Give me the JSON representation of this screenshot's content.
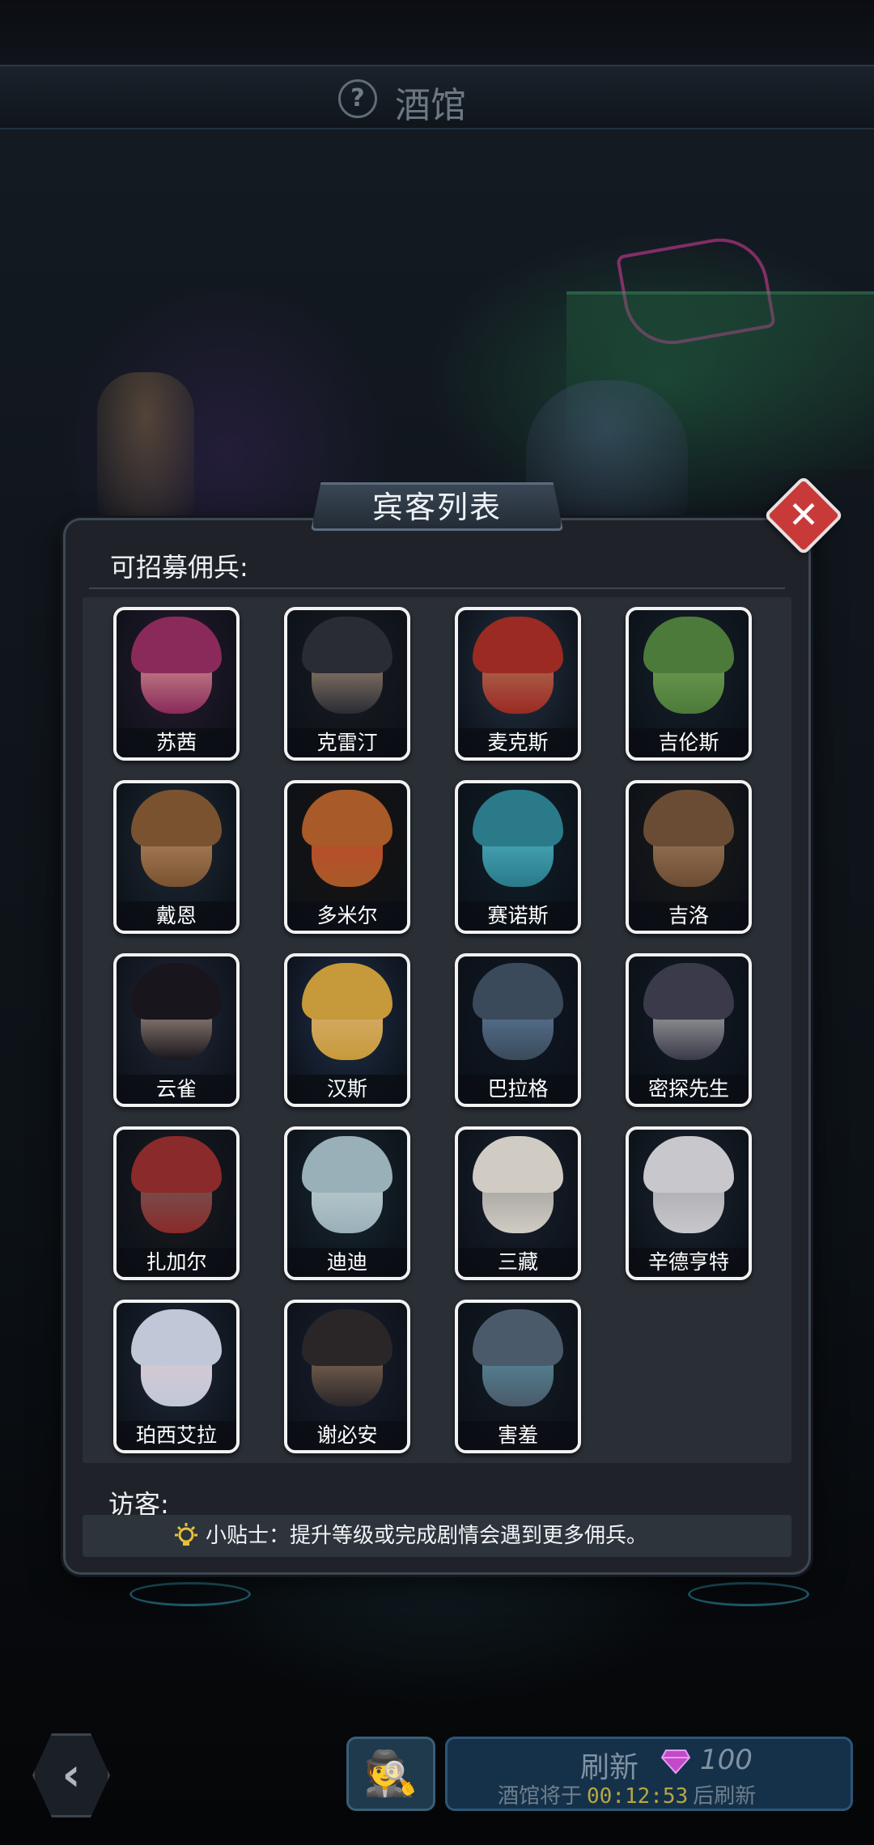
{
  "topbar": {
    "title": "酒馆",
    "help_glyph": "?"
  },
  "panel": {
    "header_title": "宾客列表",
    "close_glyph": "✕",
    "recruitable_label": "可招募佣兵:",
    "visitors_label": "访客:",
    "tip_text": "小贴士：提升等级或完成剧情会遇到更多佣兵。"
  },
  "mercenaries": [
    {
      "name": "苏茜",
      "palette": [
        "#8a2a5a",
        "#e8b9a4",
        "#2a1a30"
      ]
    },
    {
      "name": "克雷汀",
      "palette": [
        "#2a2c34",
        "#c9a987",
        "#1a1c22"
      ]
    },
    {
      "name": "麦克斯",
      "palette": [
        "#9a2a22",
        "#b98a6a",
        "#243244"
      ]
    },
    {
      "name": "吉伦斯",
      "palette": [
        "#4c7a3a",
        "#7fae5c",
        "#15202a"
      ]
    },
    {
      "name": "戴恩",
      "palette": [
        "#7a5230",
        "#c79a72",
        "#1f2a36"
      ]
    },
    {
      "name": "多米尔",
      "palette": [
        "#a85a28",
        "#c8402c",
        "#1a1410"
      ]
    },
    {
      "name": "赛诺斯",
      "palette": [
        "#2a7a8a",
        "#59c2d0",
        "#10202a"
      ]
    },
    {
      "name": "吉洛",
      "palette": [
        "#6a4c34",
        "#b58a64",
        "#1c1a18"
      ]
    },
    {
      "name": "云雀",
      "palette": [
        "#18161c",
        "#e6c7b5",
        "#22283a"
      ]
    },
    {
      "name": "汉斯",
      "palette": [
        "#c69a3a",
        "#e0b688",
        "#20304a"
      ]
    },
    {
      "name": "巴拉格",
      "palette": [
        "#3a4a5a",
        "#6a8cb4",
        "#0f1824"
      ]
    },
    {
      "name": "密探先生",
      "palette": [
        "#3a3a4a",
        "#d8d8d0",
        "#121a24"
      ]
    },
    {
      "name": "扎加尔",
      "palette": [
        "#8a2a2a",
        "#6a6a6a",
        "#1a1a1e"
      ]
    },
    {
      "name": "迪迪",
      "palette": [
        "#9ab0b8",
        "#c8d8dc",
        "#182830"
      ]
    },
    {
      "name": "三藏",
      "palette": [
        "#d0ccc4",
        "#8a8a86",
        "#1a2230"
      ]
    },
    {
      "name": "辛德亨特",
      "palette": [
        "#c8c8cc",
        "#9a9aa0",
        "#1a2430"
      ]
    },
    {
      "name": "珀西艾拉",
      "palette": [
        "#c0c8d8",
        "#e8c8d0",
        "#202a3a"
      ]
    },
    {
      "name": "谢必安",
      "palette": [
        "#2a2628",
        "#b08a6a",
        "#1a2030"
      ]
    },
    {
      "name": "害羞",
      "palette": [
        "#4a5a6a",
        "#5aa0b0",
        "#141c24"
      ]
    }
  ],
  "bottom": {
    "back_glyph": "‹",
    "agent_glyph": "🕵",
    "refresh_label": "刷新",
    "gem_count": "100",
    "refresh_prefix": "酒馆将于",
    "refresh_timer": "00:12:53",
    "refresh_suffix": "后刷新"
  },
  "colors": {
    "close_red": "#c83a3a",
    "tip_icon": "#e6c23a",
    "gem": "#c24ac8",
    "timer": "#b7a742"
  }
}
